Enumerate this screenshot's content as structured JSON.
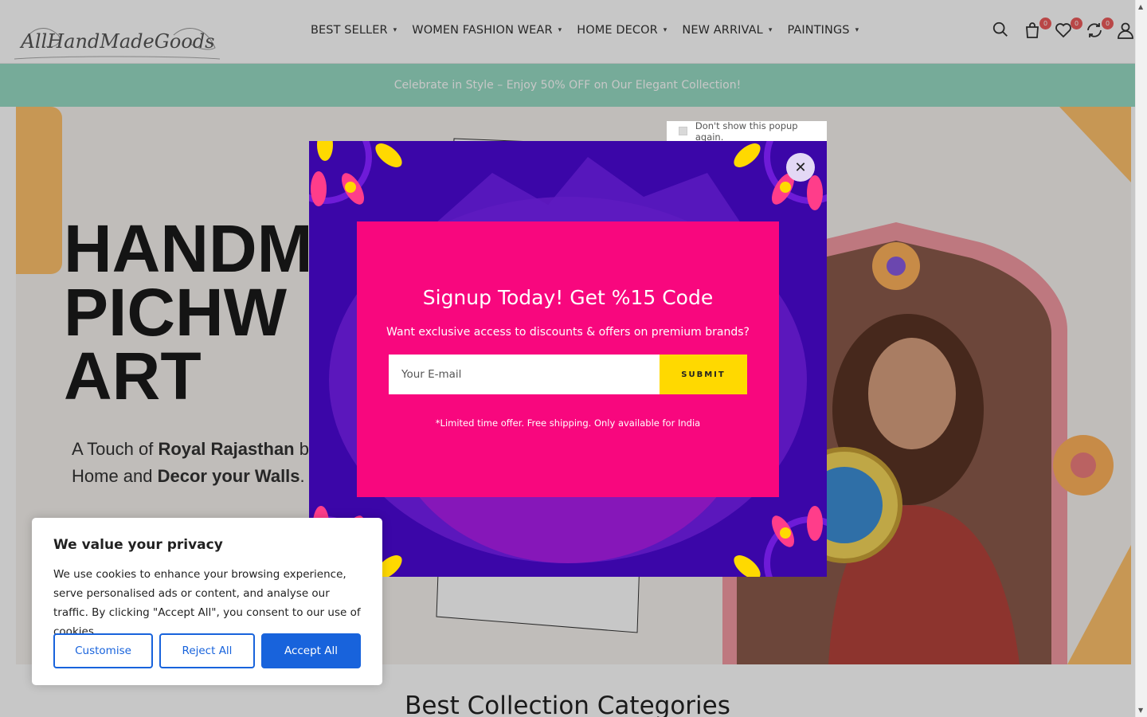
{
  "logo": {
    "text": "AllHandMadeGoods"
  },
  "nav": [
    {
      "label": "BEST SELLER"
    },
    {
      "label": "WOMEN FASHION WEAR"
    },
    {
      "label": "HOME DECOR"
    },
    {
      "label": "NEW ARRIVAL"
    },
    {
      "label": "PAINTINGS"
    }
  ],
  "header_icons": {
    "cart_count": "0",
    "wishlist_count": "0",
    "compare_count": "0"
  },
  "promo": {
    "text": "Celebrate in Style – Enjoy 50% OFF on Our Elegant Collection!"
  },
  "hero": {
    "title_line1": "HANDM",
    "title_line2": "PICHW",
    "title_line3": "ART",
    "sub_a": "A Touch of ",
    "sub_b": "Royal Rajasthan",
    "sub_c": " b",
    "sub_d": "Home and ",
    "sub_e": "Decor your Walls",
    "sub_f": "."
  },
  "categories": {
    "heading": "Best Collection Categories"
  },
  "popup": {
    "dont_show": "Don't show this popup again.",
    "title": "Signup Today! Get %15 Code",
    "description": "Want exclusive access to discounts & offers on premium brands?",
    "email_placeholder": "Your E-mail",
    "submit_label": "SUBMIT",
    "note": "*Limited time offer. Free shipping. Only available for India"
  },
  "cookie": {
    "title": "We value your privacy",
    "text": "We use cookies to enhance your browsing experience, serve personalised ads or content, and analyse our traffic. By clicking \"Accept All\", you consent to our use of cookies.",
    "customise": "Customise",
    "reject": "Reject All",
    "accept": "Accept All"
  },
  "colors": {
    "promo": "#98dcc4",
    "accent_yellow": "#ffc26c",
    "popup_bg": "#3b06a8",
    "popup_inner": "#f8077e",
    "submit": "#ffd900",
    "cookie_blue": "#1863dc"
  }
}
